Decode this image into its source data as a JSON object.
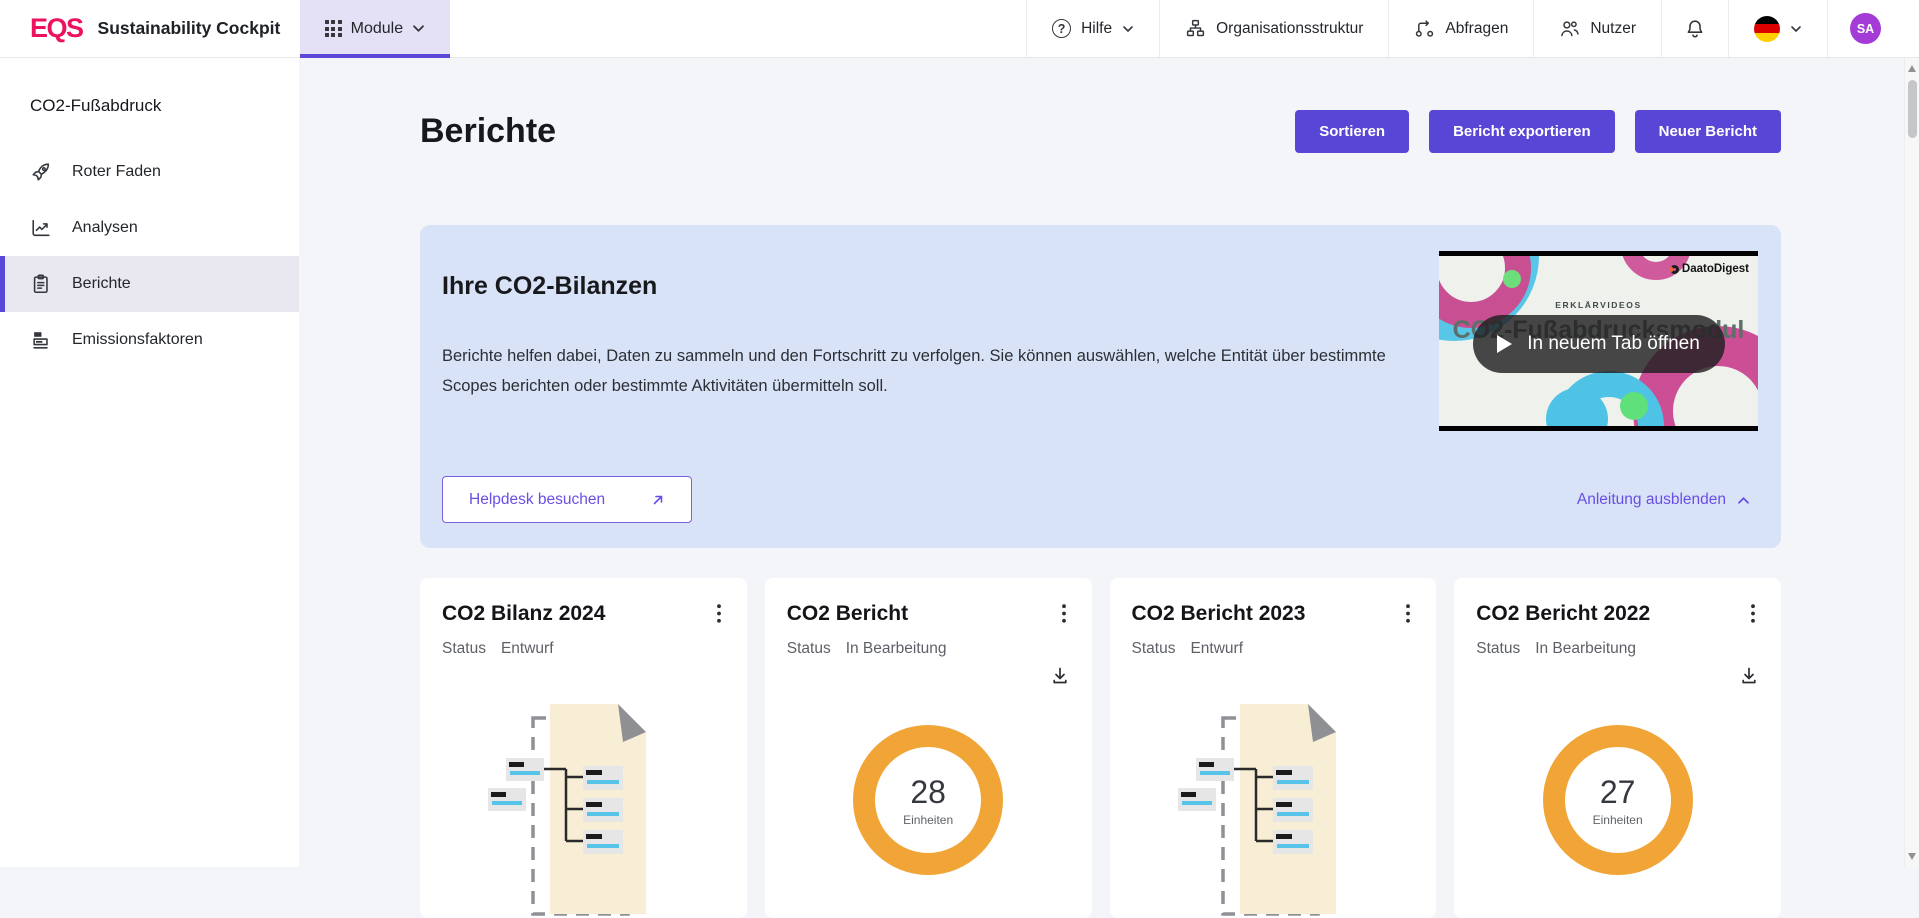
{
  "app": {
    "brand": "EQS",
    "title": "Sustainability Cockpit"
  },
  "topbar": {
    "module_tab": {
      "label": "Module"
    },
    "help": {
      "label": "Hilfe",
      "icon_glyph": "?"
    },
    "org": {
      "label": "Organisationsstruktur"
    },
    "queries": {
      "label": "Abfragen"
    },
    "users": {
      "label": "Nutzer"
    },
    "language": {
      "flag": "german-flag"
    },
    "avatar": {
      "initials": "SA"
    }
  },
  "sidebar": {
    "section_title": "CO2-Fußabdruck",
    "items": [
      {
        "label": "Roter Faden",
        "icon": "rocket-icon",
        "active": false
      },
      {
        "label": "Analysen",
        "icon": "chart-line-icon",
        "active": false
      },
      {
        "label": "Berichte",
        "icon": "clipboard-icon",
        "active": true
      },
      {
        "label": "Emissionsfaktoren",
        "icon": "emission-factors-icon",
        "active": false
      }
    ]
  },
  "main": {
    "page_title": "Berichte",
    "actions": {
      "sort": "Sortieren",
      "export": "Bericht exportieren",
      "new": "Neuer Bericht"
    },
    "banner": {
      "title": "Ihre CO2-Bilanzen",
      "description": "Berichte helfen dabei, Daten zu sammeln und den Fortschritt zu verfolgen. Sie können auswählen, welche Entität über bestimmte Scopes berichten oder bestimmte Aktivitäten übermitteln soll.",
      "helpdesk_button": "Helpdesk besuchen",
      "hide_link": "Anleitung ausblenden",
      "video": {
        "brand": "DaatoDigest",
        "kicker": "ERKLÄRVIDEOS",
        "title": "CO2-Fußabdrucksmodul",
        "open_button": "In neuem Tab öffnen"
      }
    },
    "cards": [
      {
        "title": "CO2 Bilanz 2024",
        "status_label": "Status",
        "status": "Entwurf",
        "type": "document"
      },
      {
        "title": "CO2 Bericht",
        "status_label": "Status",
        "status": "In Bearbeitung",
        "type": "donut",
        "units": "28",
        "units_label": "Einheiten"
      },
      {
        "title": "CO2 Bericht 2023",
        "status_label": "Status",
        "status": "Entwurf",
        "type": "document"
      },
      {
        "title": "CO2 Bericht 2022",
        "status_label": "Status",
        "status": "In Bearbeitung",
        "type": "donut",
        "units": "27",
        "units_label": "Einheiten"
      }
    ]
  },
  "colors": {
    "accent_purple": "#5847d6",
    "brand_pink": "#ec125f",
    "banner_blue": "#d9e3f7",
    "donut_orange": "#f1a537",
    "avatar_purple": "#a43bd6",
    "active_item_bg": "#e9e8f1",
    "flag_colors": [
      "#000000",
      "#dd0000",
      "#ffce00"
    ]
  }
}
